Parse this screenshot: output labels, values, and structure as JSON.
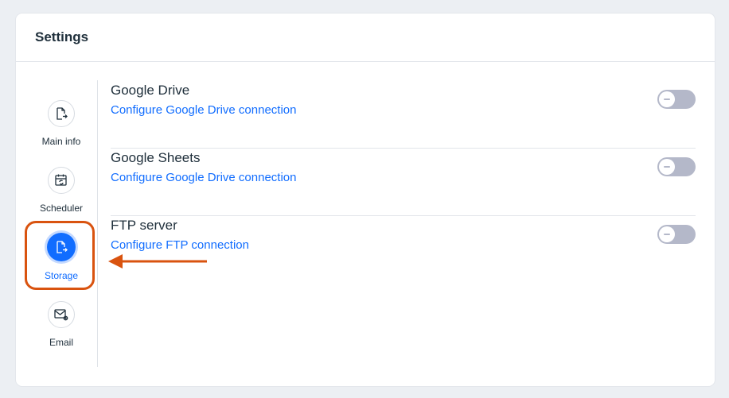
{
  "header": {
    "title": "Settings"
  },
  "sidebar": {
    "items": [
      {
        "label": "Main info",
        "icon": "file-arrow-icon",
        "active": false
      },
      {
        "label": "Scheduler",
        "icon": "calendar-refresh-icon",
        "active": false
      },
      {
        "label": "Storage",
        "icon": "file-export-icon",
        "active": true
      },
      {
        "label": "Email",
        "icon": "mail-gear-icon",
        "active": false
      }
    ]
  },
  "connections": [
    {
      "title": "Google Drive",
      "link": "Configure Google Drive connection",
      "enabled": false
    },
    {
      "title": "Google Sheets",
      "link": "Configure Google Drive connection",
      "enabled": false
    },
    {
      "title": "FTP server",
      "link": "Configure FTP connection",
      "enabled": false
    }
  ],
  "colors": {
    "accent": "#116dff",
    "highlight": "#d9530f",
    "toggle_off": "#b4b8c9"
  }
}
